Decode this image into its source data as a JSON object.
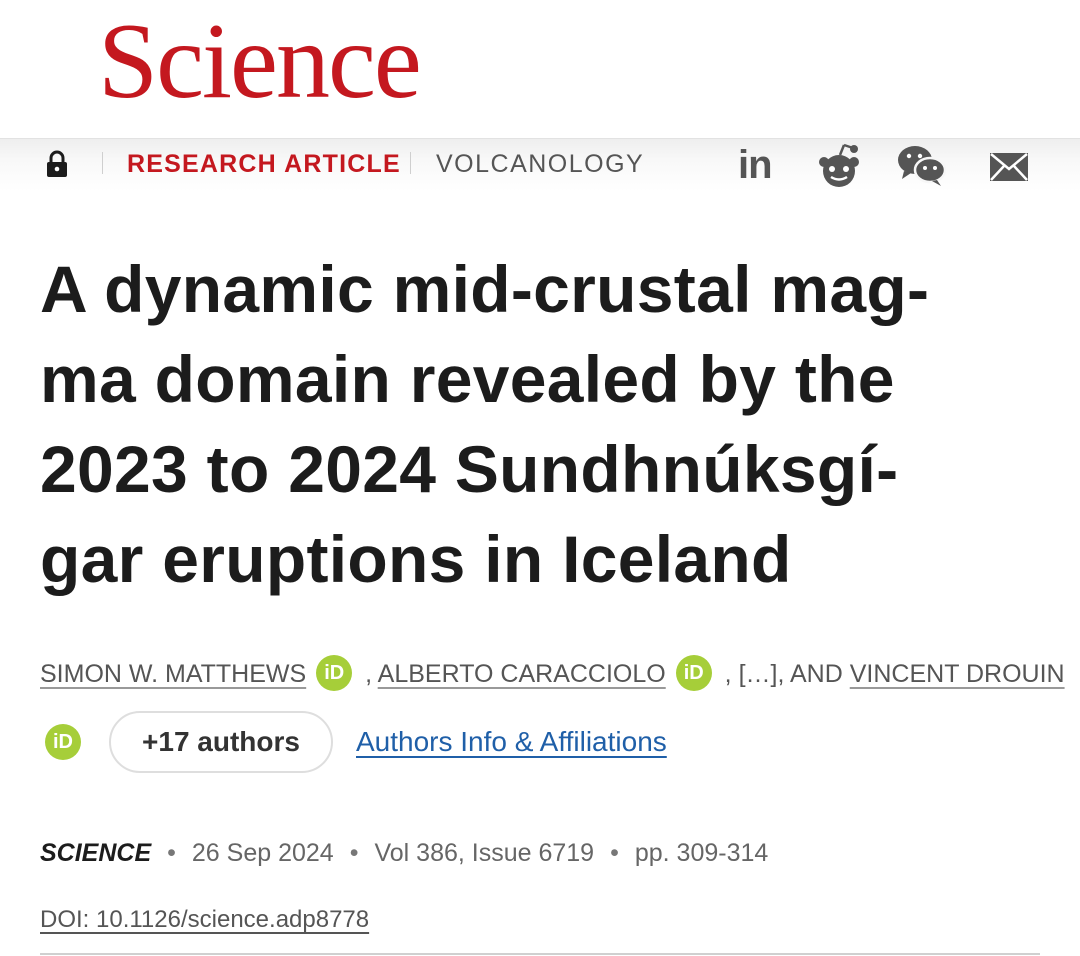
{
  "journal": {
    "logo": "Science"
  },
  "toolbar": {
    "article_type": "RESEARCH ARTICLE",
    "subject": "VOLCANOLOGY",
    "share_icons": [
      "linkedin-icon",
      "reddit-icon",
      "wechat-icon",
      "email-icon"
    ],
    "linkedin_text": "in"
  },
  "article": {
    "title_lines": [
      "A dynamic mid-crustal mag-",
      "ma domain revealed by the",
      "2023 to 2024 Sundhnúksgí-",
      "gar eruptions in Iceland"
    ],
    "authors": {
      "first": "SIMON W. MATTHEWS",
      "second": "ALBERTO CARACCIOLO",
      "sep1": " ,",
      "sep2": " ,",
      "ellipsis": " […], AND ",
      "last": "VINCENT DROUIN",
      "orcid_label": "iD",
      "more": "+17 authors",
      "affiliations": "Authors Info & Affiliations"
    },
    "meta": {
      "journal": "SCIENCE",
      "date": "26 Sep 2024",
      "volume": "Vol 386, Issue 6719",
      "pages": "pp. 309-314",
      "separator": "•"
    },
    "doi": "DOI: 10.1126/science.adp8778"
  },
  "colors": {
    "brand": "#c4181f",
    "link": "#1f5fa8",
    "orcid": "#a6ce39"
  }
}
